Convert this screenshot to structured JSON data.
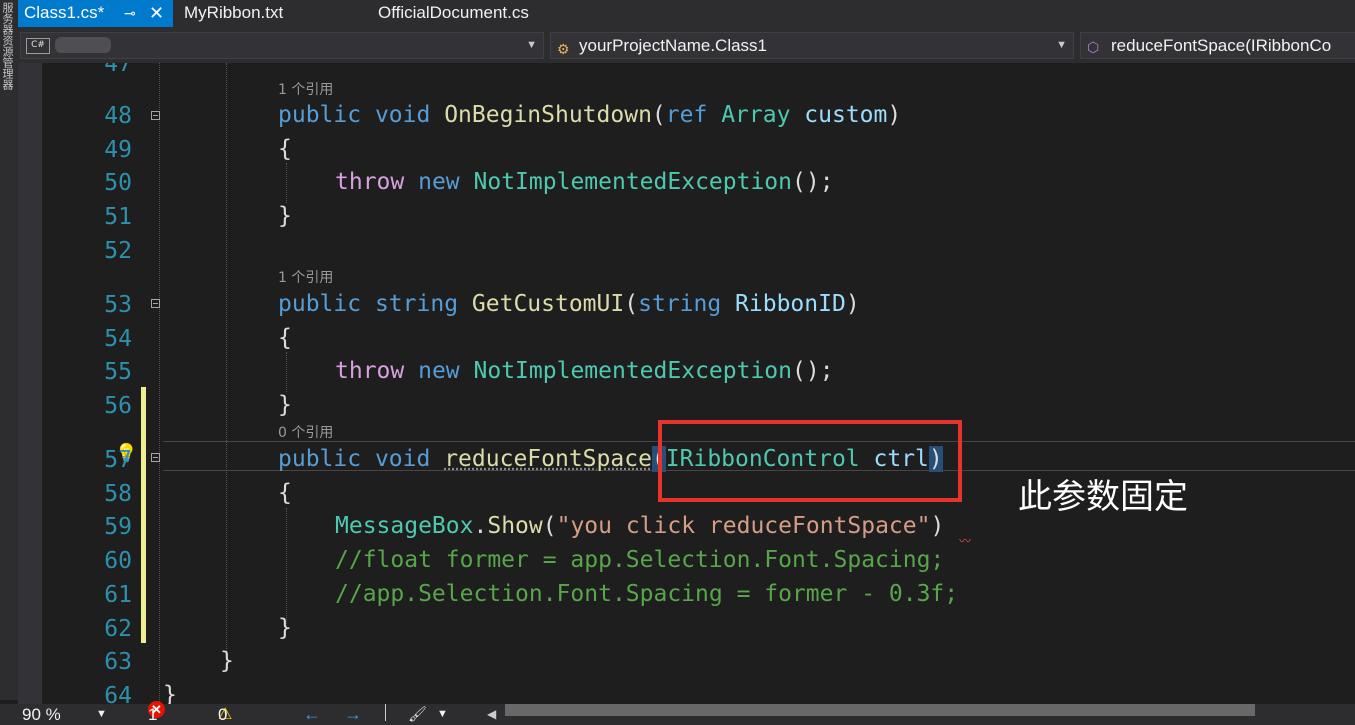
{
  "tabs": [
    {
      "label": "Class1.cs*",
      "active": true
    },
    {
      "label": "MyRibbon.txt",
      "active": false
    },
    {
      "label": "OfficialDocument.cs",
      "active": false
    }
  ],
  "tab_pin_icon": "pin-icon",
  "tab_close_icon": "close-icon",
  "left_tool_text": "服务器资源管理器",
  "nav": {
    "project_badge": "C#",
    "class_label": "yourProjectName.Class1",
    "member_label": "reduceFontSpace(IRibbonCo"
  },
  "code_lens": {
    "ref48": "1 个引用",
    "ref53": "1 个引用",
    "ref57": "0 个引用"
  },
  "line_numbers": [
    "47",
    "48",
    "49",
    "50",
    "51",
    "52",
    "53",
    "54",
    "55",
    "56",
    "57",
    "58",
    "59",
    "60",
    "61",
    "62",
    "63",
    "64"
  ],
  "code": {
    "l48": {
      "kw1": "public",
      "kw2": "void",
      "method": "OnBeginShutdown",
      "paren": "(",
      "kw3": "ref",
      "type": "Array",
      "param": "custom",
      "close": ")"
    },
    "open_brace": "{",
    "close_brace": "}",
    "l50": {
      "ctl": "throw",
      "kw": "new",
      "type": "NotImplementedException",
      "rest": "();"
    },
    "l53": {
      "kw1": "public",
      "kw2": "string",
      "method": "GetCustomUI",
      "paren": "(",
      "kw3": "string",
      "param": "RibbonID",
      "close": ")"
    },
    "l57": {
      "kw1": "public",
      "kw2": "void",
      "method": "reduceFontSpace",
      "paren": "(",
      "type": "IRibbonControl",
      "param": "ctrl",
      "close": ")"
    },
    "l59": {
      "type": "MessageBox",
      "dot": ".",
      "method": "Show",
      "open": "(",
      "str": "\"you click reduceFontSpace\"",
      "close": ")"
    },
    "l60": "//float former = app.Selection.Font.Spacing;",
    "l61": "//app.Selection.Font.Spacing = former - 0.3f;"
  },
  "annotation": "此参数固定",
  "status": {
    "zoom": "90 %",
    "errors": "1",
    "warnings": "0"
  },
  "colors": {
    "accent": "#007acc",
    "keyword": "#569cd6",
    "type": "#4ec9b0",
    "method": "#dcdcaa",
    "comment": "#57a64a",
    "string": "#d69d85",
    "annotation_box": "#e8322c"
  }
}
